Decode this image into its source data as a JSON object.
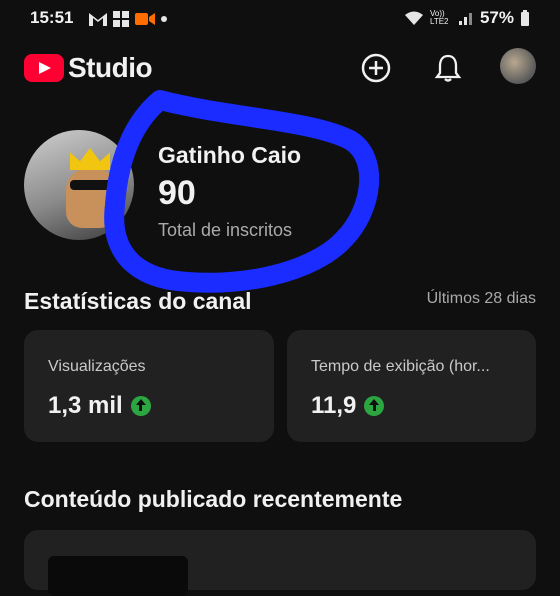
{
  "status_bar": {
    "time": "15:51",
    "notification_icons": [
      "gmail-icon",
      "app-grid-icon",
      "video-camera-icon",
      "dot-icon"
    ],
    "network_label": "Vo)) LTE2",
    "battery_percent": "57%"
  },
  "header": {
    "logo_text": "Studio",
    "brand_color": "#ff0033"
  },
  "channel": {
    "name": "Gatinho Caio",
    "subscriber_count": "90",
    "subscriber_label": "Total de inscritos"
  },
  "stats": {
    "title": "Estatísticas do canal",
    "period": "Últimos 28 dias",
    "cards": [
      {
        "label": "Visualizações",
        "value": "1,3 mil",
        "trend": "up"
      },
      {
        "label": "Tempo de exibição (hor...",
        "value": "11,9",
        "trend": "up"
      }
    ],
    "trend_color": "#2ba640"
  },
  "recent": {
    "title": "Conteúdo publicado recentemente"
  },
  "annotation": {
    "color": "#1a2cff"
  }
}
